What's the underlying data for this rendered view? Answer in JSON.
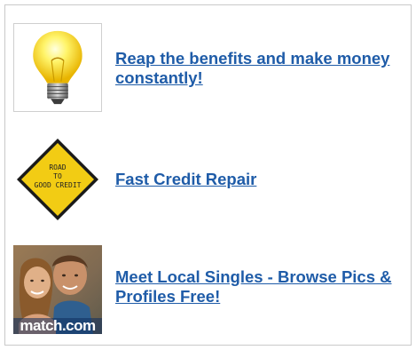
{
  "ads": [
    {
      "icon": "lightbulb-icon",
      "link_text": "Reap the benefits and make money constantly!"
    },
    {
      "icon": "road-sign-icon",
      "sign_text": [
        "ROAD",
        "TO",
        "GOOD CREDIT"
      ],
      "link_text": "Fast Credit Repair"
    },
    {
      "icon": "couple-photo",
      "brand_watermark": "match.com",
      "link_text": "Meet Local Singles - Browse Pics & Profiles Free!"
    }
  ],
  "colors": {
    "link": "#1f5ca8",
    "border": "#c9c9c9",
    "sign_yellow": "#f2cc14",
    "bulb_glow": "#fff46a"
  }
}
